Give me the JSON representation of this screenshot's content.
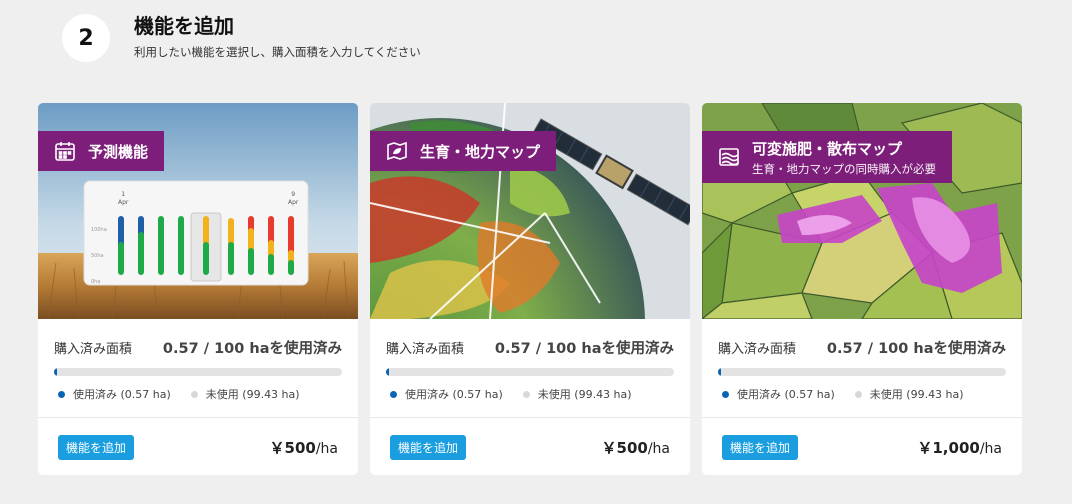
{
  "step": {
    "number": "2",
    "title": "機能を追加",
    "subtitle": "利用したい機能を選択し、購入面積を入力してください"
  },
  "cards": [
    {
      "title": "予測機能",
      "subtitle": "",
      "icon": "calendar-icon",
      "chart": {
        "date_start": "1",
        "month_start": "Apr",
        "date_end": "9",
        "month_end": "Apr",
        "ticks": [
          "100ha",
          "50ha",
          "0ha"
        ]
      },
      "usage_label": "購入済み面積",
      "usage_value": "0.57 / 100 haを使用済み",
      "used_fraction": 0.0057,
      "legend_used": "使用済み (0.57 ha)",
      "legend_unused": "未使用 (99.43 ha)",
      "add_button": "機能を追加",
      "price": "￥500",
      "price_unit": "/ha"
    },
    {
      "title": "生育・地力マップ",
      "subtitle": "",
      "icon": "leaf-map-icon",
      "usage_label": "購入済み面積",
      "usage_value": "0.57 / 100 haを使用済み",
      "used_fraction": 0.0057,
      "legend_used": "使用済み (0.57 ha)",
      "legend_unused": "未使用 (99.43 ha)",
      "add_button": "機能を追加",
      "price": "￥500",
      "price_unit": "/ha"
    },
    {
      "title": "可変施肥・散布マップ",
      "subtitle": "生育・地力マップの同時購入が必要",
      "icon": "wave-map-icon",
      "usage_label": "購入済み面積",
      "usage_value": "0.57 / 100 haを使用済み",
      "used_fraction": 0.0057,
      "legend_used": "使用済み (0.57 ha)",
      "legend_unused": "未使用 (99.43 ha)",
      "add_button": "機能を追加",
      "price": "￥1,000",
      "price_unit": "/ha"
    }
  ],
  "colors": {
    "tag_bg": "#7d1f7a",
    "button_bg": "#1a9ee0",
    "bar_fill": "#0a64b4"
  }
}
